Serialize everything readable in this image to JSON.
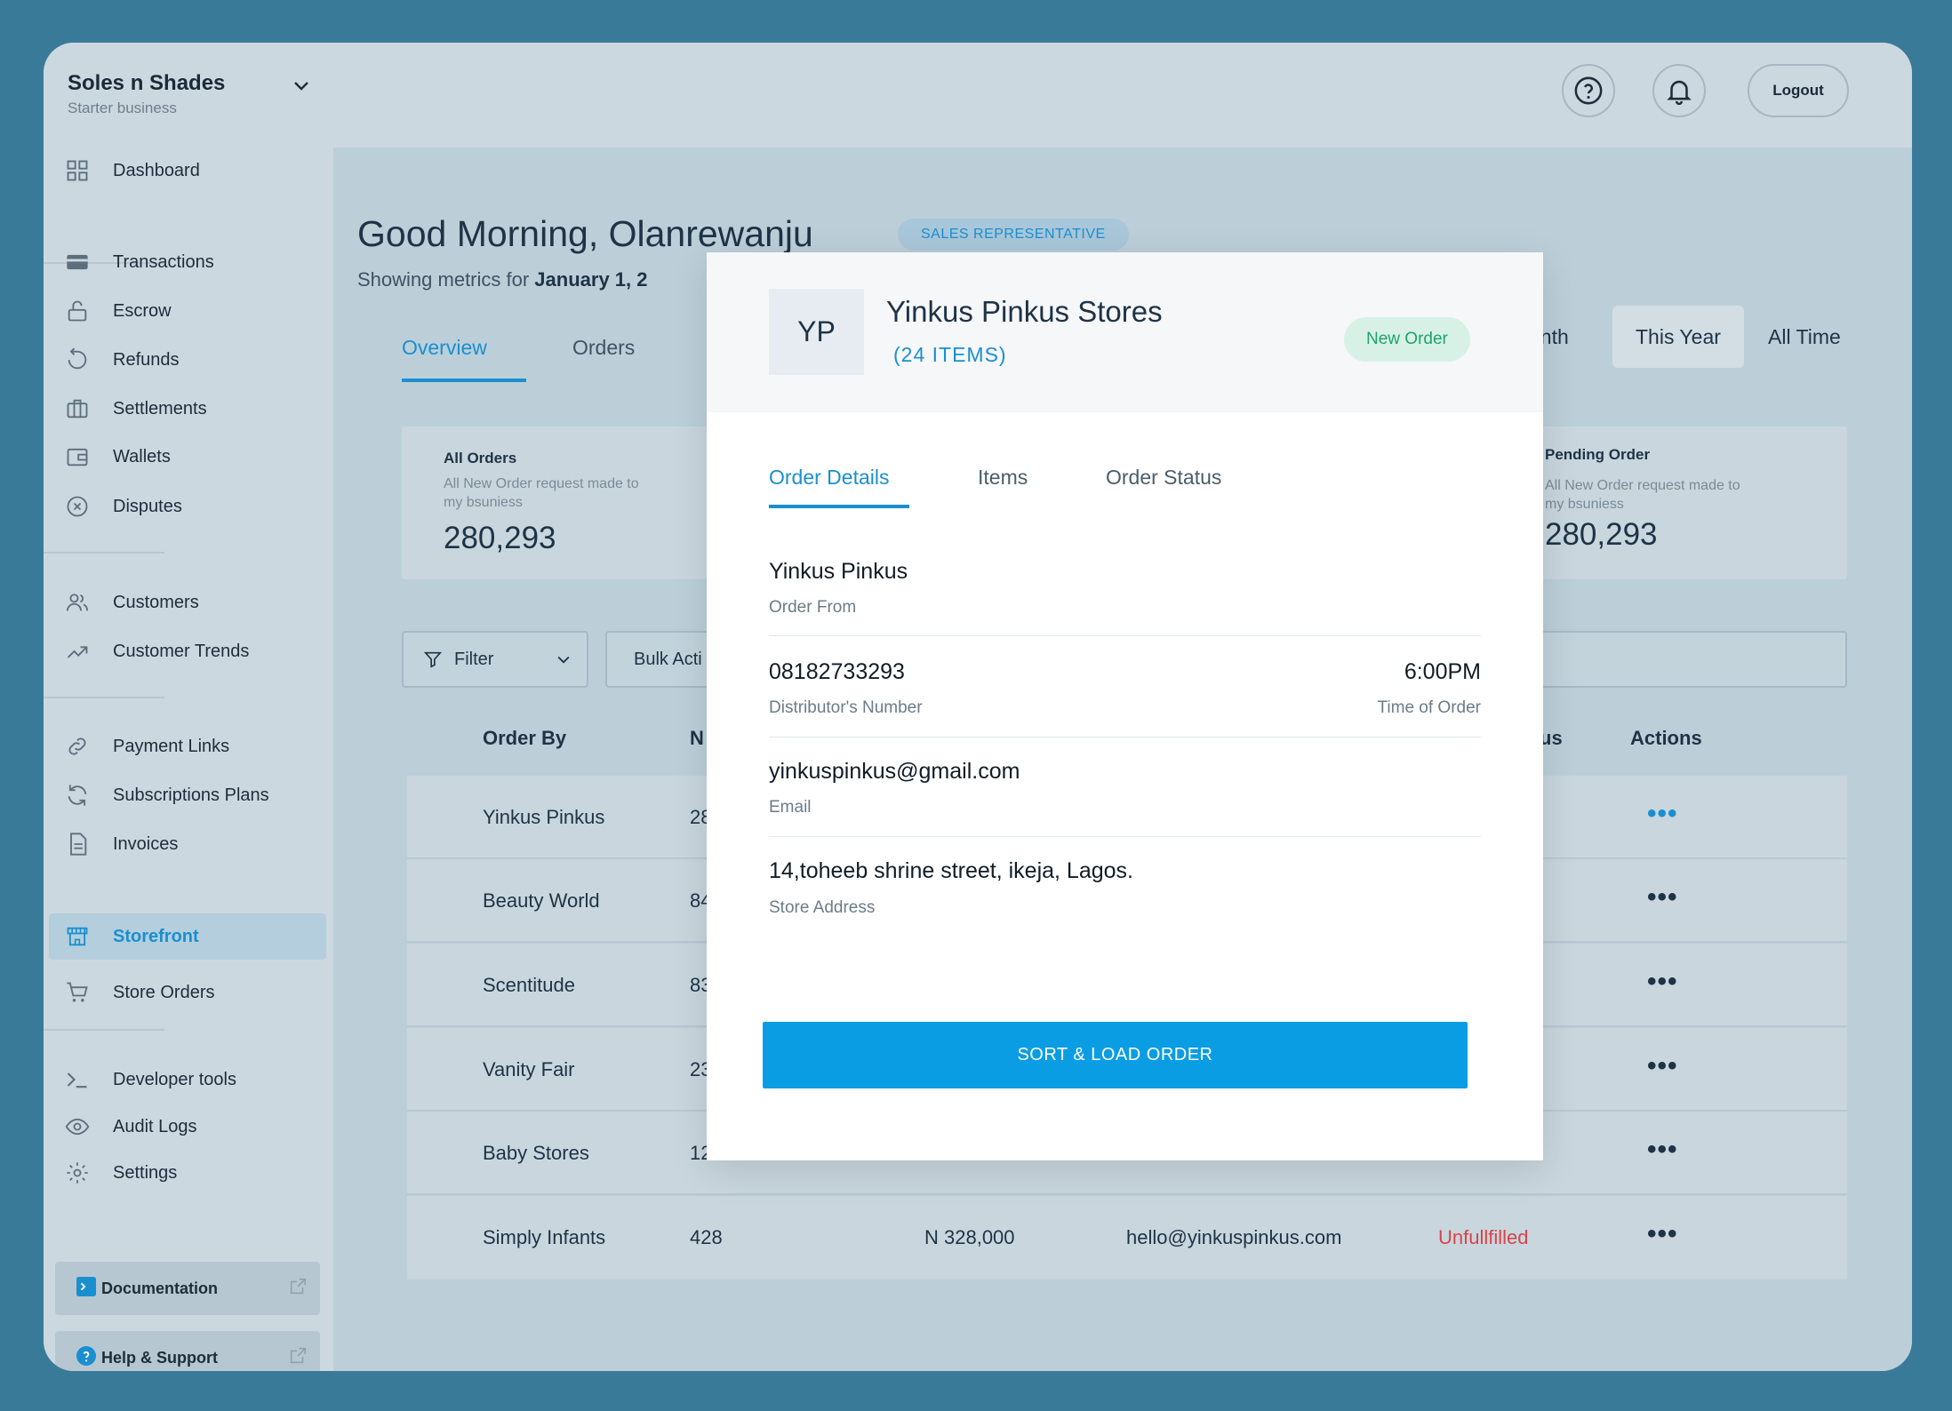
{
  "brand": {
    "name": "Soles n Shades",
    "subtitle": "Starter business"
  },
  "topbar": {
    "logout_label": "Logout"
  },
  "sidebar": {
    "items": [
      {
        "label": "Dashboard",
        "icon": "grid-icon"
      },
      {
        "label": "Transactions",
        "icon": "card-icon"
      },
      {
        "label": "Escrow",
        "icon": "lock-icon"
      },
      {
        "label": "Refunds",
        "icon": "refund-icon"
      },
      {
        "label": "Settlements",
        "icon": "briefcase-icon"
      },
      {
        "label": "Wallets",
        "icon": "wallet-icon"
      },
      {
        "label": "Disputes",
        "icon": "x-circle-icon"
      },
      {
        "label": "Customers",
        "icon": "users-icon"
      },
      {
        "label": "Customer Trends",
        "icon": "trend-icon"
      },
      {
        "label": "Payment Links",
        "icon": "link-icon"
      },
      {
        "label": "Subscriptions Plans",
        "icon": "refresh-icon"
      },
      {
        "label": "Invoices",
        "icon": "document-icon"
      },
      {
        "label": "Storefront",
        "icon": "store-icon",
        "active": true
      },
      {
        "label": "Store Orders",
        "icon": "cart-icon"
      },
      {
        "label": "Developer tools",
        "icon": "terminal-icon"
      },
      {
        "label": "Audit Logs",
        "icon": "eye-icon"
      },
      {
        "label": "Settings",
        "icon": "gear-icon"
      }
    ],
    "documentation_label": "Documentation",
    "help_label": "Help & Support"
  },
  "main": {
    "greeting": "Good Morning, Olanrewanju",
    "role_badge": "SALES REPRESENTATIVE",
    "metrics_prefix": "Showing metrics for ",
    "metrics_date": "January 1, 2",
    "tabs": [
      {
        "label": "Overview"
      },
      {
        "label": "Orders"
      }
    ],
    "periods": [
      {
        "label": "onth"
      },
      {
        "label": "This Year"
      },
      {
        "label": "All Time"
      }
    ],
    "stats": [
      {
        "title": "All Orders",
        "desc": "All New Order request made to my bsuniess",
        "value": "280,293"
      },
      {
        "title": "Pending Order",
        "desc": "All New Order request made to my bsuniess",
        "value": "280,293"
      }
    ],
    "filter_label": "Filter",
    "bulk_label": "Bulk Acti",
    "columns": {
      "order_by": "Order By",
      "number": "N",
      "status": "us",
      "actions": "Actions"
    },
    "rows": [
      {
        "name": "Yinkus Pinkus",
        "num": "28",
        "amount": "",
        "email": "",
        "status": ""
      },
      {
        "name": "Beauty World",
        "num": "84",
        "amount": "",
        "email": "",
        "status": ""
      },
      {
        "name": "Scentitude",
        "num": "83",
        "amount": "",
        "email": "",
        "status": ""
      },
      {
        "name": "Vanity Fair",
        "num": "23",
        "amount": "",
        "email": "",
        "status": ""
      },
      {
        "name": "Baby Stores",
        "num": "12",
        "amount": "",
        "email": "",
        "status": ""
      },
      {
        "name": "Simply Infants",
        "num": "428",
        "amount": "N 328,000",
        "email": "hello@yinkuspinkus.com",
        "status": "Unfullfilled"
      }
    ],
    "more_glyph": "•••"
  },
  "modal": {
    "avatar_initials": "YP",
    "title": "Yinkus Pinkus Stores",
    "items_count": "(24 ITEMS)",
    "status_badge": "New Order",
    "tabs": [
      {
        "label": "Order Details"
      },
      {
        "label": "Items"
      },
      {
        "label": "Order Status"
      }
    ],
    "order_from": {
      "value": "Yinkus Pinkus",
      "label": "Order From"
    },
    "distributor_number": {
      "value": "08182733293",
      "label": "Distributor's Number"
    },
    "time_of_order": {
      "value": "6:00PM",
      "label": "Time of Order"
    },
    "email": {
      "value": "yinkuspinkus@gmail.com",
      "label": "Email"
    },
    "address": {
      "value": "14,toheeb shrine street, ikeja, Lagos.",
      "label": "Store Address"
    },
    "primary_button": "SORT & LOAD ORDER"
  },
  "colors": {
    "accent": "#1a8fd0",
    "button": "#0b9de3",
    "success": "#1fa36b",
    "danger": "#d9434a"
  }
}
